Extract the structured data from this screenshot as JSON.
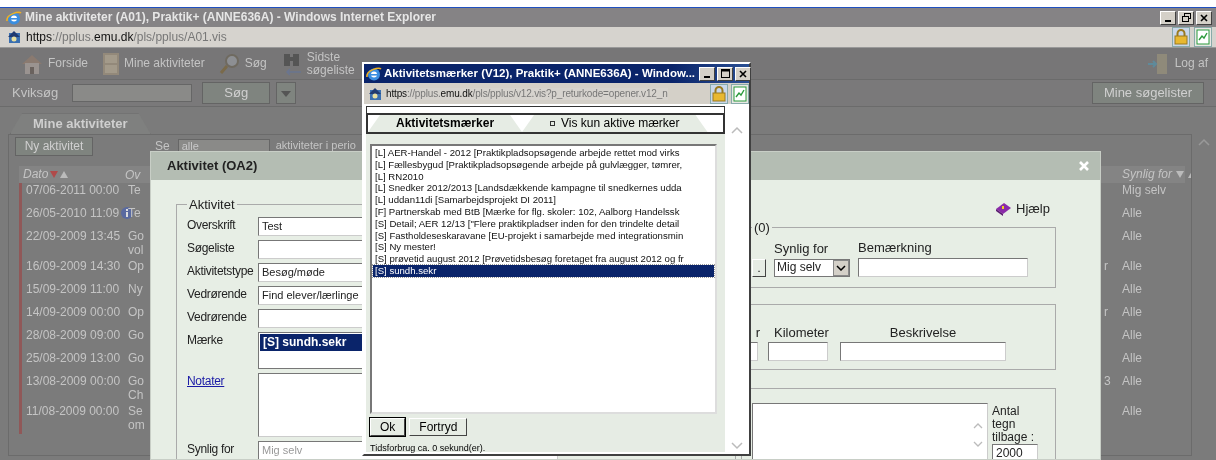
{
  "browser": {
    "title": "Mine aktiviteter (A01), Praktik+ (ANNE636A) - Windows Internet Explorer",
    "address": [
      {
        "text": "https",
        "strong": true
      },
      {
        "text": "://pplus.",
        "strong": false
      },
      {
        "text": "emu.dk",
        "strong": true
      },
      {
        "text": "/pls/pplus/A01.vis",
        "strong": false
      }
    ]
  },
  "toolbar": [
    {
      "kind": "house",
      "label": [
        "Forside"
      ]
    },
    {
      "kind": "cabinet",
      "label": [
        "Mine aktiviteter"
      ]
    },
    {
      "kind": "magnifier",
      "label": [
        "Søg"
      ]
    },
    {
      "kind": "binoculars",
      "label": [
        "Sidste",
        "søgeliste"
      ]
    }
  ],
  "logout": {
    "label": "Log af"
  },
  "quicksearch": {
    "label": "Kviksøg",
    "button": "Søg"
  },
  "saved_searches_button": "Mine søgelister",
  "tabs": [
    {
      "label": "Mine aktiviteter",
      "selected": true
    }
  ],
  "list": {
    "new_button": "Ny aktivitet",
    "filter_label": "Se",
    "filter_value": "alle",
    "filter_suffix": "aktiviteter i perio",
    "columns": [
      {
        "label": "Dato"
      },
      {
        "label": "Ov"
      },
      {
        "label": "Synlig for"
      }
    ],
    "rows": [
      {
        "date": "07/06-2011 00:00",
        "info": false,
        "text": [
          "Te"
        ],
        "visible": "Mig selv"
      },
      {
        "date": "26/05-2010 11:09",
        "info": true,
        "text": [
          "Te"
        ],
        "visible": "Alle"
      },
      {
        "date": "22/09-2009 13:45",
        "info": false,
        "text": [
          "Go",
          "vol"
        ],
        "visible": "Alle"
      },
      {
        "date": "16/09-2009 14:30",
        "info": false,
        "text": [
          "Op"
        ],
        "column_3": "r",
        "visible": "Alle"
      },
      {
        "date": "15/09-2009 11:00",
        "info": false,
        "text": [
          "Ny"
        ],
        "visible": "Alle"
      },
      {
        "date": "14/09-2009 00:00",
        "info": false,
        "text": [
          "Op"
        ],
        "column_3": "r",
        "visible": "Alle"
      },
      {
        "date": "28/08-2009 09:00",
        "info": false,
        "text": [
          "Go"
        ],
        "visible": "Alle"
      },
      {
        "date": "25/08-2009 13:00",
        "info": false,
        "text": [
          "Go"
        ],
        "visible": "Alle"
      },
      {
        "date": "13/08-2009 00:00",
        "info": false,
        "text": [
          "Go",
          "Ch"
        ],
        "column_3": "3",
        "visible": "Alle"
      },
      {
        "date": "11/08-2009 00:00",
        "info": false,
        "text": [
          "Se",
          "om"
        ],
        "visible": "Alle"
      }
    ]
  },
  "dialog": {
    "title": "Aktivitet (OA2)",
    "help": "Hjælp",
    "section": {
      "legend": "Aktivitet",
      "fields": [
        {
          "kind": "input",
          "label": "Overskrift",
          "value": "Test"
        },
        {
          "kind": "input",
          "label": "Søgeliste"
        },
        {
          "kind": "input",
          "label": "Aktivitetstype",
          "value": "Besøg/møde"
        },
        {
          "kind": "input",
          "label": "Vedrørende",
          "value": "Find elever/lærlinge"
        },
        {
          "kind": "input",
          "label": "Vedrørende"
        },
        {
          "kind": "listbox",
          "label": "Mærke",
          "options": [
            {
              "label": "[S] sundh.sekr",
              "selected": true
            }
          ]
        },
        {
          "kind": "textarea",
          "label": "Notater"
        },
        {
          "kind": "input",
          "label": "Synlig for",
          "value": "Mig selv",
          "disabled": true
        }
      ]
    },
    "participants": {
      "legend": "(0)",
      "button": ".",
      "visibility_label": "Synlig for",
      "visibility_value": "Mig selv",
      "remark_label": "Bemærkning"
    },
    "mileage": {
      "column_1": "r",
      "km_label": "Kilometer",
      "description_label": "Beskrivelse"
    },
    "notes": {
      "counter_label": "Antal tegn tilbage :",
      "counter_value": "2000"
    }
  },
  "popup": {
    "title": "Aktivitetsmærker (V12), Praktik+ (ANNE636A) - Window...",
    "address": [
      {
        "text": "https",
        "strong": true
      },
      {
        "text": "://pplus.",
        "strong": false
      },
      {
        "text": "emu.dk",
        "strong": true
      },
      {
        "text": "/pls/pplus/v12.vis?p_returkode=opener.v12_n",
        "strong": false
      }
    ],
    "tabs": [
      {
        "label": "Aktivitetsmærker",
        "selected": true
      },
      {
        "label": "Vis kun aktive mærker",
        "selected": false
      }
    ],
    "items": [
      {
        "label": "[L] AER-Handel - 2012 [Praktikpladsopsøgende arbejde rettet mod virks",
        "selected": false
      },
      {
        "label": "[L] Fællesbygud [Praktikpladsopsøgende arbejde på gulvlægger, tømrer,",
        "selected": false
      },
      {
        "label": "[L] RN2010",
        "selected": false
      },
      {
        "label": "[L] Snedker 2012/2013 [Landsdækkende kampagne til snedkernes udda",
        "selected": false
      },
      {
        "label": "[L] uddan11di [Samarbejdsprojekt DI 2011]",
        "selected": false
      },
      {
        "label": "[F] Partnerskab med BtB [Mærke for flg. skoler: 102, Aalborg Handelssk",
        "selected": false
      },
      {
        "label": "[S] Detail; AER 12/13 [\"Flere praktikpladser inden for den trindelte detail",
        "selected": false
      },
      {
        "label": "[S] Fastholdeseskaravane [EU-projekt i samarbejde med integrationsmin",
        "selected": false
      },
      {
        "label": "[S] Ny mester!",
        "selected": false
      },
      {
        "label": "[S] prøvetid august 2012 [Prøvetidsbesøg foretaget fra august 2012 og fr",
        "selected": false
      },
      {
        "label": "[S] sundh.sekr",
        "selected": true
      }
    ],
    "buttons": [
      {
        "label": "Ok",
        "default": true
      },
      {
        "label": "Fortryd",
        "default": false
      }
    ],
    "status": "Tidsforbrug ca. 0 sekund(er)."
  }
}
